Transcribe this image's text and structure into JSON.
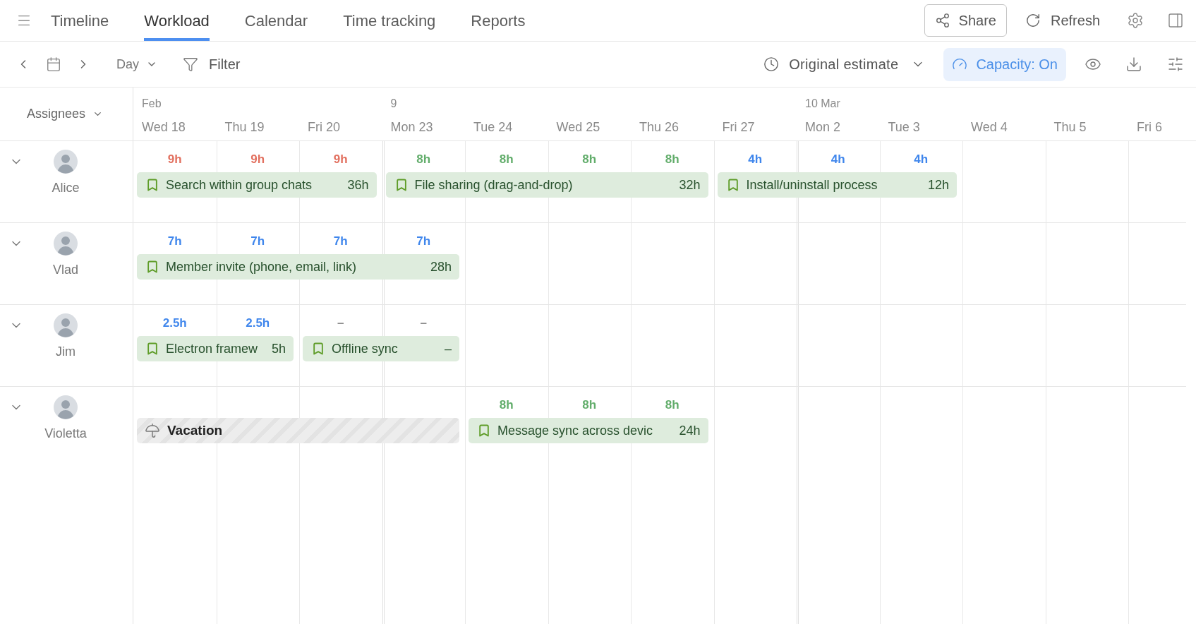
{
  "nav": {
    "tabs": [
      {
        "label": "Timeline",
        "selected": false
      },
      {
        "label": "Workload",
        "selected": true
      },
      {
        "label": "Calendar",
        "selected": false
      },
      {
        "label": "Time tracking",
        "selected": false
      },
      {
        "label": "Reports",
        "selected": false
      }
    ],
    "share": "Share",
    "refresh": "Refresh"
  },
  "toolbar": {
    "view": "Day",
    "filter": "Filter",
    "estimate": "Original estimate",
    "capacity": {
      "label": "Capacity: On",
      "on": true
    }
  },
  "header": {
    "assignees_label": "Assignees",
    "weeks": [
      {
        "label": "Feb",
        "days": [
          "Wed 18",
          "Thu 19",
          "Fri 20"
        ]
      },
      {
        "label": "9",
        "days": [
          "Mon 23",
          "Tue 24",
          "Wed 25",
          "Thu 26",
          "Fri 27"
        ]
      },
      {
        "label": "10 Mar",
        "days": [
          "Mon 2",
          "Tue 3",
          "Wed 4",
          "Thu 5",
          "Fri 6"
        ]
      }
    ]
  },
  "assignees": [
    {
      "name": "Alice",
      "items": [
        {
          "kind": "task",
          "title": "Search within group chats",
          "total": "36h",
          "days": [
            {
              "hours": "9h",
              "color": "#e2705f"
            },
            {
              "hours": "9h",
              "color": "#e2705f"
            },
            {
              "hours": "9h",
              "color": "#e2705f"
            }
          ]
        },
        {
          "kind": "task",
          "title": "File sharing (drag-and-drop)",
          "total": "32h",
          "days": [
            {
              "hours": "8h",
              "color": "#62ad6b"
            },
            {
              "hours": "8h",
              "color": "#62ad6b"
            },
            {
              "hours": "8h",
              "color": "#62ad6b"
            },
            {
              "hours": "8h",
              "color": "#62ad6b"
            }
          ]
        },
        {
          "kind": "task",
          "title": "Install/uninstall process",
          "total": "12h",
          "days": [
            {
              "hours": "4h",
              "color": "#3f86ec"
            },
            {
              "hours": "4h",
              "color": "#3f86ec"
            },
            {
              "hours": "4h",
              "color": "#3f86ec"
            }
          ]
        }
      ]
    },
    {
      "name": "Vlad",
      "items": [
        {
          "kind": "task",
          "title": "Member invite (phone, email, link)",
          "total": "28h",
          "days": [
            {
              "hours": "7h",
              "color": "#3f86ec"
            },
            {
              "hours": "7h",
              "color": "#3f86ec"
            },
            {
              "hours": "7h",
              "color": "#3f86ec"
            },
            {
              "hours": "7h",
              "color": "#3f86ec"
            }
          ]
        }
      ]
    },
    {
      "name": "Jim",
      "items": [
        {
          "kind": "task",
          "title": "Electron framew",
          "total": "5h",
          "days": [
            {
              "hours": "2.5h",
              "color": "#3f86ec"
            },
            {
              "hours": "2.5h",
              "color": "#3f86ec"
            }
          ]
        },
        {
          "kind": "task",
          "title": "Offline sync",
          "total": "–",
          "days": [
            {
              "hours": "–",
              "color": "#8c8c8c"
            },
            {
              "hours": "–",
              "color": "#8c8c8c"
            }
          ]
        }
      ]
    },
    {
      "name": "Violetta",
      "items": [
        {
          "kind": "vacation",
          "title": "Vacation",
          "days": [
            {
              "off": true
            },
            {
              "off": true
            },
            {
              "off": true
            },
            {
              "off": true
            }
          ]
        },
        {
          "kind": "task",
          "title": "Message sync across devic",
          "total": "24h",
          "days": [
            {
              "hours": "8h",
              "color": "#62ad6b"
            },
            {
              "hours": "8h",
              "color": "#62ad6b"
            },
            {
              "hours": "8h",
              "color": "#62ad6b"
            }
          ]
        }
      ]
    }
  ]
}
